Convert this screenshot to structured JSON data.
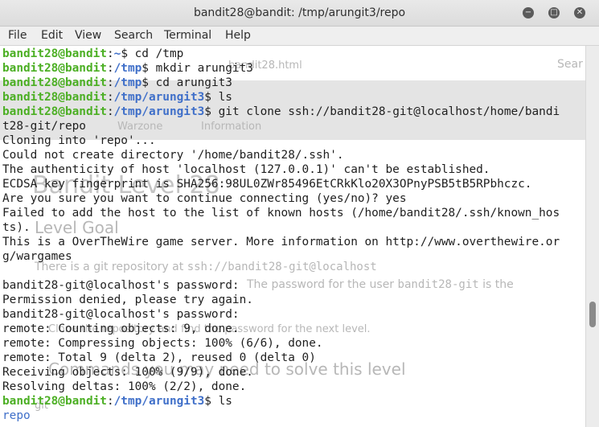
{
  "window": {
    "title": "bandit28@bandit: /tmp/arungit3/repo",
    "minimize": "−",
    "maximize": "□",
    "close": "✕"
  },
  "menu": [
    "File",
    "Edit",
    "View",
    "Search",
    "Terminal",
    "Help"
  ],
  "prompt": {
    "user": "bandit28@bandit",
    "sep": ":",
    "suffix": "$"
  },
  "lines": [
    {
      "kind": "cmd",
      "path": "~",
      "cmd": " cd /tmp"
    },
    {
      "kind": "cmd",
      "path": "/tmp",
      "cmd": " mkdir arungit3"
    },
    {
      "kind": "cmd",
      "path": "/tmp",
      "cmd": " cd arungit3"
    },
    {
      "kind": "cmd",
      "path": "/tmp/arungit3",
      "cmd": " ls"
    },
    {
      "kind": "cmd",
      "path": "/tmp/arungit3",
      "cmd": " git clone ssh://bandit28-git@localhost/home/bandi"
    },
    {
      "kind": "out",
      "text": "t28-git/repo"
    },
    {
      "kind": "out",
      "text": "Cloning into 'repo'..."
    },
    {
      "kind": "out",
      "text": "Could not create directory '/home/bandit28/.ssh'."
    },
    {
      "kind": "out",
      "text": "The authenticity of host 'localhost (127.0.0.1)' can't be established."
    },
    {
      "kind": "out",
      "text": "ECDSA key fingerprint is SHA256:98UL0ZWr85496EtCRkKlo20X3OPnyPSB5tB5RPbhczc."
    },
    {
      "kind": "out",
      "text": "Are you sure you want to continue connecting (yes/no)? yes"
    },
    {
      "kind": "out",
      "text": "Failed to add the host to the list of known hosts (/home/bandit28/.ssh/known_hos"
    },
    {
      "kind": "out",
      "text": "ts)."
    },
    {
      "kind": "out",
      "text": "This is a OverTheWire game server. More information on http://www.overthewire.or"
    },
    {
      "kind": "out",
      "text": "g/wargames"
    },
    {
      "kind": "out",
      "text": ""
    },
    {
      "kind": "out",
      "text": "bandit28-git@localhost's password:"
    },
    {
      "kind": "out",
      "text": "Permission denied, please try again."
    },
    {
      "kind": "out",
      "text": "bandit28-git@localhost's password:"
    },
    {
      "kind": "out",
      "text": "remote: Counting objects: 9, done."
    },
    {
      "kind": "out",
      "text": "remote: Compressing objects: 100% (6/6), done."
    },
    {
      "kind": "out",
      "text": "remote: Total 9 (delta 2), reused 0 (delta 0)"
    },
    {
      "kind": "out",
      "text": "Receiving objects: 100% (9/9), done."
    },
    {
      "kind": "out",
      "text": "Resolving deltas: 100% (2/2), done."
    },
    {
      "kind": "cmd",
      "path": "/tmp/arungit3",
      "cmd": " ls"
    },
    {
      "kind": "dir",
      "text": "repo"
    }
  ],
  "background_page": {
    "url_fragment": "bandit28.html",
    "search_placeholder": "Sear",
    "nav_warzone": "Warzone",
    "nav_information": "Information",
    "heading": "Bandit Level 28",
    "level_goal": "Level Goal",
    "goal_text_1": "There is a git repository at",
    "goal_code_1": "ssh://bandit28-git@localhost",
    "goal_text_2": "The password for the user",
    "goal_code_2": "bandit28-git",
    "goal_text_3": "is the",
    "goal_text_4": "Clone the repository and find the password for the next level.",
    "commands_heading": "Commands you may need to solve this level",
    "cmd_git": "git"
  }
}
